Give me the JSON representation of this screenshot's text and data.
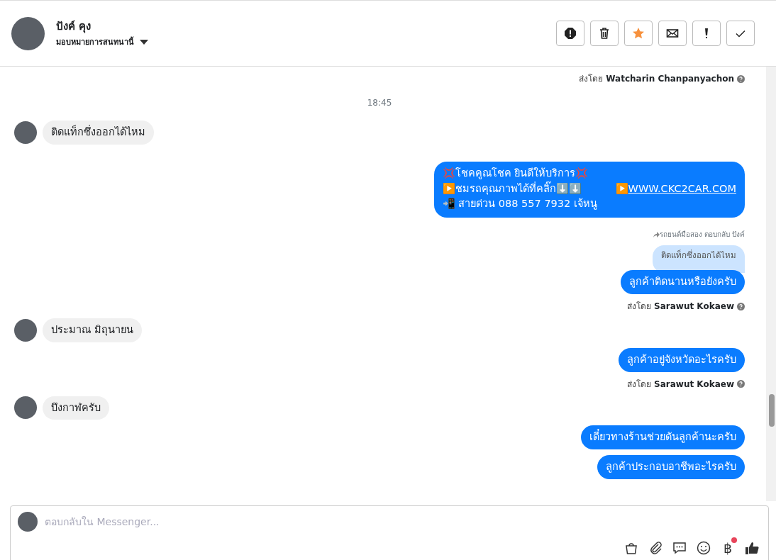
{
  "header": {
    "name": "ปังค์ คุง",
    "assign_label": "มอบหมายการสนทนานี้",
    "actions": [
      {
        "kind": "spam"
      },
      {
        "kind": "trash"
      },
      {
        "kind": "star",
        "on": true
      },
      {
        "kind": "mail"
      },
      {
        "kind": "alert"
      },
      {
        "kind": "done"
      }
    ]
  },
  "messages": [
    {
      "kind": "sent_by",
      "prefix": "ส่งโดย",
      "name": "Watcharin Chanpanyachon"
    },
    {
      "kind": "time",
      "text": "18:45"
    },
    {
      "kind": "incoming",
      "text": "ติดแท็กซึ่งออกได้ไหม"
    },
    {
      "kind": "outgoing_rich",
      "lines": [
        "💢โชคคูณโชค ยินดีให้บริการ💢",
        "▶️ชมรถคุณภาพได้ที่คลิ๊ก⬇️⬇️",
        "📲 สายด่วน 088 557 7932 เจ้หนู"
      ],
      "link_prefix": "▶️",
      "link": "WWW.CKC2CAR.COM"
    },
    {
      "kind": "reply_note",
      "text": "รถยนต์มือสอง ตอบกลับ ปังค์"
    },
    {
      "kind": "quote",
      "text": "ติดแท็กซึ่งออกได้ไหม"
    },
    {
      "kind": "outgoing",
      "text": "ลูกค้าติดนานหรือยังครับ"
    },
    {
      "kind": "sent_by",
      "prefix": "ส่งโดย",
      "name": "Sarawut Kokaew"
    },
    {
      "kind": "incoming",
      "text": "ประมาณ มิถุนายน"
    },
    {
      "kind": "outgoing",
      "text": "ลูกค้าอยู่จังหวัดอะไรครับ"
    },
    {
      "kind": "sent_by",
      "prefix": "ส่งโดย",
      "name": "Sarawut Kokaew"
    },
    {
      "kind": "incoming",
      "text": "บึงกาฬครับ"
    },
    {
      "kind": "outgoing",
      "text": "เดี๋ยวทางร้านช่วยดันลูกค้านะครับ"
    },
    {
      "kind": "outgoing",
      "text": "ลูกค้าประกอบอาชีพอะไรครับ"
    }
  ],
  "composer": {
    "placeholder": "ตอบกลับใน Messenger...",
    "tools": [
      {
        "kind": "bag"
      },
      {
        "kind": "clip"
      },
      {
        "kind": "chat"
      },
      {
        "kind": "smile"
      },
      {
        "kind": "baht",
        "text": "฿",
        "badge": true
      },
      {
        "kind": "like"
      }
    ]
  }
}
